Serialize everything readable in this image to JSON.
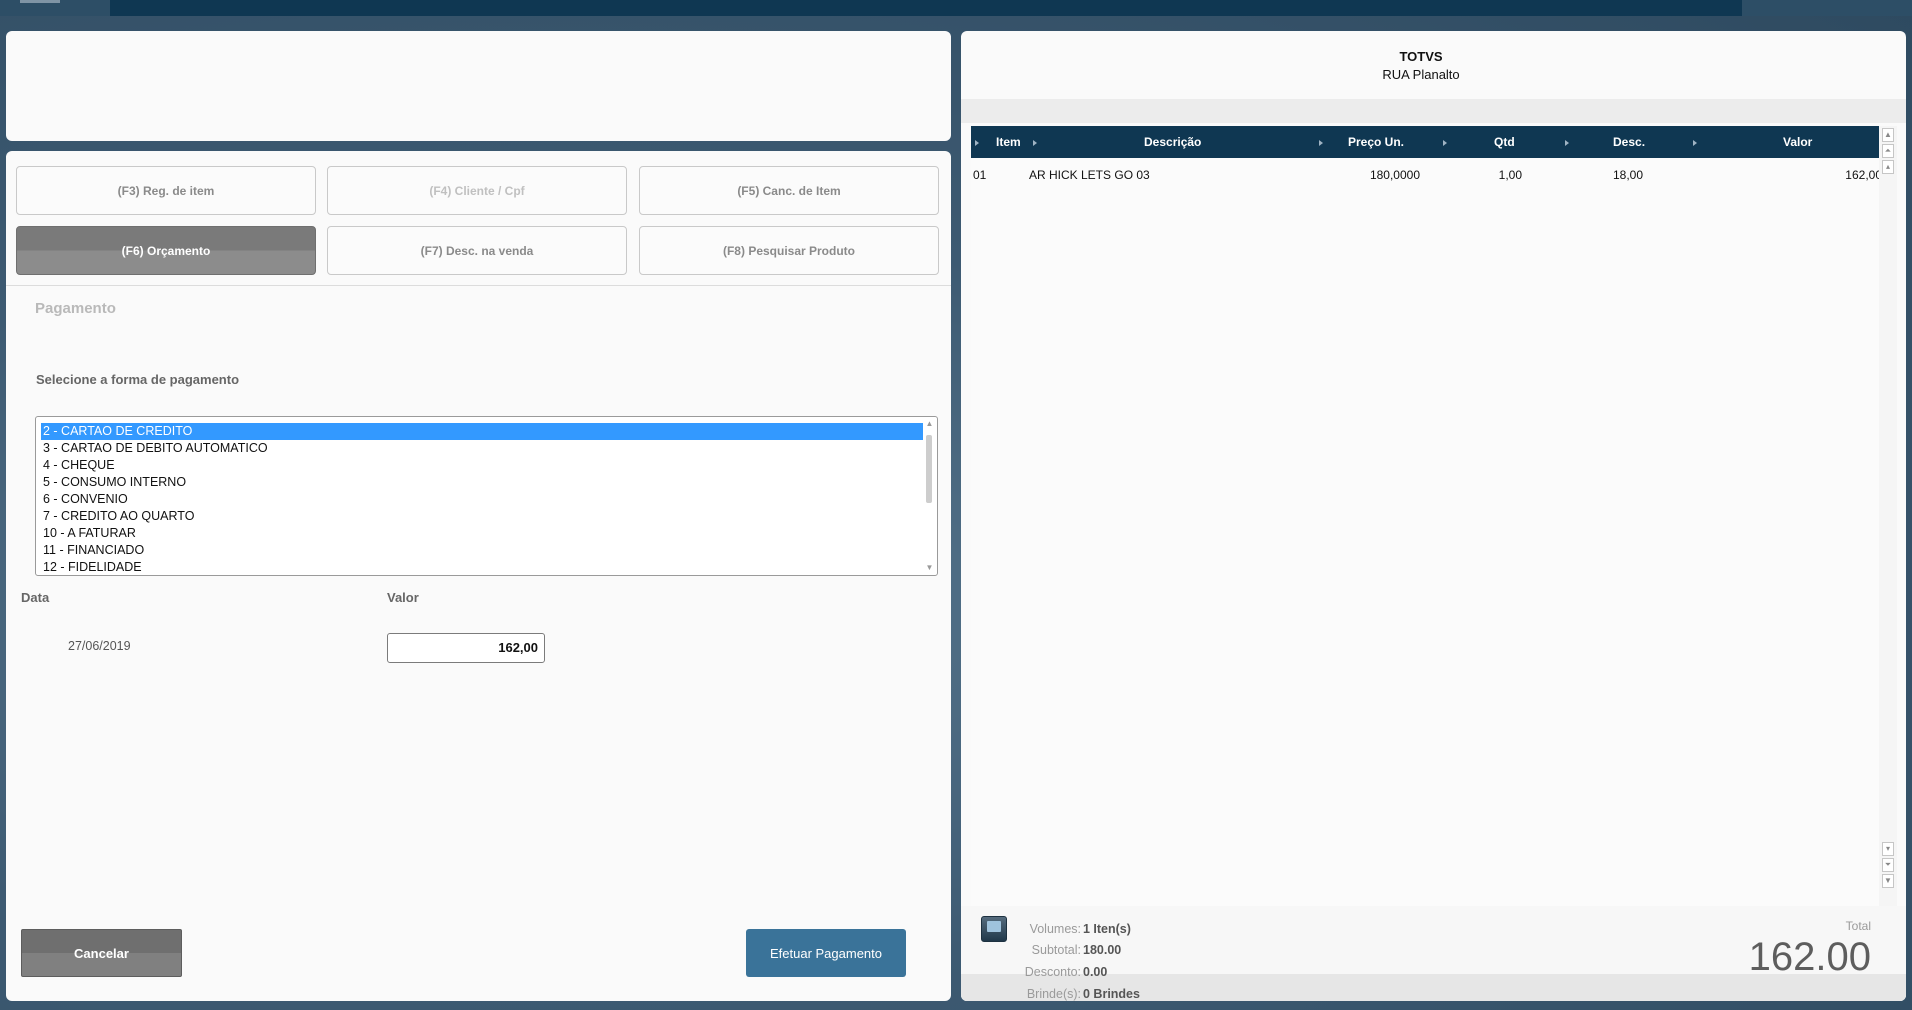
{
  "store": {
    "name": "TOTVS",
    "address": "RUA Planalto"
  },
  "function_buttons": [
    {
      "label": "(F3) Reg. de item"
    },
    {
      "label": "(F4) Cliente / Cpf"
    },
    {
      "label": "(F5) Canc. de Item"
    },
    {
      "label": "(F6) Orçamento"
    },
    {
      "label": "(F7) Desc. na venda"
    },
    {
      "label": "(F8) Pesquisar Produto"
    }
  ],
  "payment": {
    "section_title": "Pagamento",
    "select_label": "Selecione a forma de pagamento",
    "options": [
      "2 - CARTAO DE CREDITO",
      "3 - CARTAO DE DEBITO AUTOMATICO",
      "4 - CHEQUE",
      "5 - CONSUMO INTERNO",
      "6 - CONVENIO",
      "7 - CREDITO AO QUARTO",
      "10 - A FATURAR",
      "11 - FINANCIADO",
      "12 - FIDELIDADE"
    ],
    "selected": "2 - CARTAO DE CREDITO",
    "date_label": "Data",
    "date_value": "27/06/2019",
    "value_label": "Valor",
    "value": "162,00",
    "cancel_label": "Cancelar",
    "pay_label": "Efetuar Pagamento"
  },
  "items_table": {
    "headers": [
      "Item",
      "Descrição",
      "Preço Un.",
      "Qtd",
      "Desc.",
      "Valor"
    ],
    "rows": [
      [
        "01",
        "AR HICK LETS GO 03",
        "180,0000",
        "1,00",
        "18,00",
        "162,00"
      ]
    ]
  },
  "summary": {
    "volumes_label": "Volumes:",
    "volumes_value": "1 Iten(s)",
    "subtotal_label": "Subtotal:",
    "subtotal_value": "180.00",
    "discount_label": "Desconto:",
    "discount_value": "0.00",
    "gifts_label": "Brinde(s):",
    "gifts_value": "0 Brindes",
    "total_label": "Total",
    "total_value": "162.00"
  }
}
